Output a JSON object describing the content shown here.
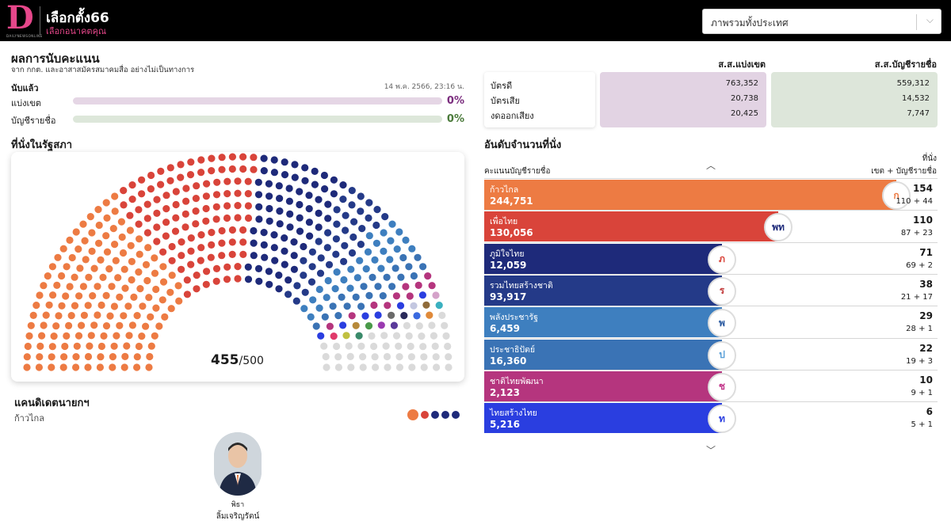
{
  "header": {
    "logo_letter": "D",
    "logo_sub": "DAILYNEWSONLINE",
    "title": "เลือกตั้ง66",
    "subtitle": "เลือกอนาคตคุณ",
    "region_select": "ภาพรวมทั้งประเทศ"
  },
  "summary": {
    "title": "ผลการนับคะแนน",
    "subtitle": "จาก กกต. และอาสาสมัครสมาคมสื่อ อย่างไม่เป็นทางการ",
    "counted_label": "นับแล้ว",
    "timestamp": "14 พ.ค. 2566, 23:16 น.",
    "progress": [
      {
        "label": "แบ่งเขต",
        "pct_text": "0%",
        "fraction": 0.0,
        "track_color": "#e5d6e5",
        "text_color": "#7b2d7e"
      },
      {
        "label": "บัญชีรายชื่อ",
        "pct_text": "0%",
        "fraction": 0.0,
        "track_color": "#dde7da",
        "text_color": "#4a7a3a"
      }
    ]
  },
  "parliament": {
    "title": "ที่นั่งในรัฐสภา",
    "seats_counted": "455",
    "seats_total": "/500"
  },
  "candidate": {
    "title": "แคนดิเดตนายกฯ",
    "party": "ก้าวไกล",
    "first_name": "พิธา",
    "last_name": "ลิ้มเจริญรัตน์",
    "dot_colors": [
      "#ed7b43",
      "#d9443a",
      "#1e2a7a",
      "#1e2a7a",
      "#1e2a7a"
    ]
  },
  "votes": {
    "col1_head": "ส.ส.แบ่งเขต",
    "col2_head": "ส.ส.บัญชีรายชื่อ",
    "rows": [
      {
        "label": "บัตรดี",
        "district": "763,352",
        "party_list": "559,312"
      },
      {
        "label": "บัตรเสีย",
        "district": "20,738",
        "party_list": "14,532"
      },
      {
        "label": "งดออกเสียง",
        "district": "20,425",
        "party_list": "7,747"
      }
    ]
  },
  "ranking": {
    "title": "อันดับจำนวนที่นั่ง",
    "left_head": "คะแนนบัญชีรายชื่อ",
    "right_head_1": "ที่นั่ง",
    "right_head_2": "เขต + บัญชีรายชื่อ",
    "parties": [
      {
        "name": "ก้าวไกล",
        "votes": "244,751",
        "seats": "154",
        "split": "110 + 44",
        "seat_count": 154,
        "color": "#ed7b43",
        "logo": "ก",
        "logo_color": "#ed7b43"
      },
      {
        "name": "เพื่อไทย",
        "votes": "130,056",
        "seats": "110",
        "split": "87 + 23",
        "seat_count": 110,
        "color": "#d9443a",
        "logo": "พท",
        "logo_color": "#1e2a7a"
      },
      {
        "name": "ภูมิใจไทย",
        "votes": "12,059",
        "seats": "71",
        "split": "69 + 2",
        "seat_count": 71,
        "color": "#1e2a7a",
        "logo": "ภ",
        "logo_color": "#d9443a"
      },
      {
        "name": "รวมไทยสร้างชาติ",
        "votes": "93,917",
        "seats": "38",
        "split": "21 + 17",
        "seat_count": 38,
        "color": "#243a88",
        "logo": "ร",
        "logo_color": "#c23a3a"
      },
      {
        "name": "พลังประชารัฐ",
        "votes": "6,459",
        "seats": "29",
        "split": "28 + 1",
        "seat_count": 29,
        "color": "#3e7fbf",
        "logo": "พ",
        "logo_color": "#2b5aa0"
      },
      {
        "name": "ประชาธิปัตย์",
        "votes": "16,360",
        "seats": "22",
        "split": "19 + 3",
        "seat_count": 22,
        "color": "#3a73b5",
        "logo": "ป",
        "logo_color": "#5aa0d8"
      },
      {
        "name": "ชาติไทยพัฒนา",
        "votes": "2,123",
        "seats": "10",
        "split": "9 + 1",
        "seat_count": 10,
        "color": "#b5357e",
        "logo": "ช",
        "logo_color": "#c2358a"
      },
      {
        "name": "ไทยสร้างไทย",
        "votes": "5,216",
        "seats": "6",
        "split": "5 + 1",
        "seat_count": 6,
        "color": "#2a3ee0",
        "logo": "ท",
        "logo_color": "#2a3ee0"
      }
    ]
  },
  "small_party_colors": [
    "#d4a2c9",
    "#b78a3a",
    "#c3c7e0",
    "#6a6a6a",
    "#8f6b3a",
    "#e03a6a",
    "#4a9a4a",
    "#2a2a5a",
    "#3ab0c0",
    "#c0c040",
    "#9a3ab0",
    "#3a6ae0",
    "#e08a3a",
    "#5a3a9a",
    "#3a8a6a"
  ],
  "unfilled_color": "#dadada"
}
